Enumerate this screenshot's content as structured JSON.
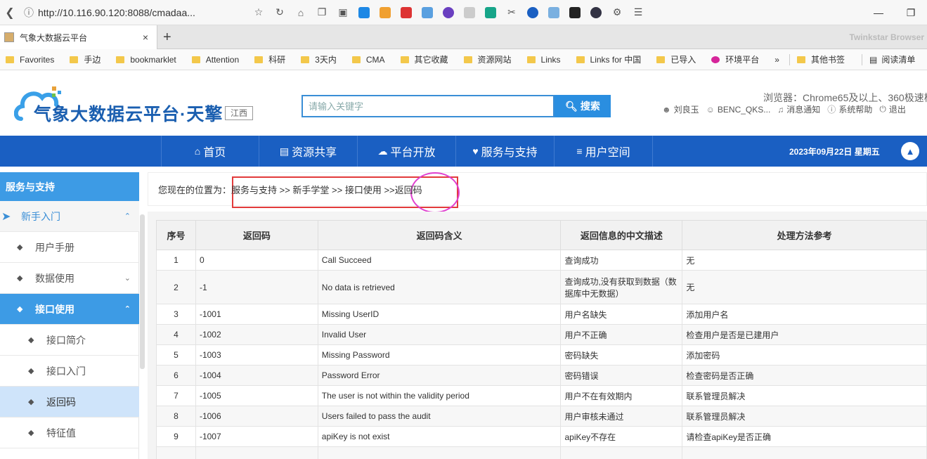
{
  "browser": {
    "url": "http://10.116.90.120:8088/cmadaa...",
    "tab_title": "气象大数据云平台",
    "brand": "Twinkstar Browser",
    "new_tab": "+",
    "close": "×"
  },
  "bookmarks": [
    "Favorites",
    "手边",
    "bookmarklet",
    "Attention",
    "科研",
    "3天内",
    "CMA",
    "其它收藏",
    "资源网站",
    "Links",
    "Links for 中国",
    "已导入",
    "环境平台",
    "»",
    "其他书签",
    "阅读清单"
  ],
  "site": {
    "logo_text": "气象大数据云平台·天擎",
    "region": "江西",
    "search_placeholder": "请输入关键字",
    "search_button": "搜索",
    "browser_note": "浏览器：Chrome65及以上、360极速模",
    "user_name": "刘良玉",
    "account": "BENC_QKS...",
    "notify": "消息通知",
    "help": "系统帮助",
    "logout": "退出"
  },
  "nav": {
    "items": [
      "首页",
      "资源共享",
      "平台开放",
      "服务与支持",
      "用户空间"
    ],
    "date": "2023年09月22日 星期五"
  },
  "sidebar": {
    "title": "服务与支持",
    "items": [
      {
        "label": "新手入门"
      },
      {
        "label": "用户手册"
      },
      {
        "label": "数据使用"
      },
      {
        "label": "接口使用"
      },
      {
        "label": "接口简介"
      },
      {
        "label": "接口入门"
      },
      {
        "label": "返回码"
      },
      {
        "label": "特征值"
      }
    ]
  },
  "breadcrumb": {
    "prefix": "您现在的位置为：",
    "path": "服务与支持 >> 新手学堂 >> 接口使用 >> ",
    "current": "返回码"
  },
  "table": {
    "headers": [
      "序号",
      "返回码",
      "返回码含义",
      "返回信息的中文描述",
      "处理方法参考"
    ],
    "rows": [
      [
        "1",
        "0",
        "Call Succeed",
        "查询成功",
        "无"
      ],
      [
        "2",
        "-1",
        "No data is retrieved",
        "查询成功,没有获取到数据（数据库中无数据）",
        "无"
      ],
      [
        "3",
        "-1001",
        "Missing UserID",
        "用户名缺失",
        "添加用户名"
      ],
      [
        "4",
        "-1002",
        "Invalid User",
        "用户不正确",
        "检查用户是否是已建用户"
      ],
      [
        "5",
        "-1003",
        "Missing Password",
        "密码缺失",
        "添加密码"
      ],
      [
        "6",
        "-1004",
        "Password Error",
        "密码错误",
        "检查密码是否正确"
      ],
      [
        "7",
        "-1005",
        "The user is not within the validity period",
        "用户不在有效期内",
        "联系管理员解决"
      ],
      [
        "8",
        "-1006",
        "Users failed to pass the audit",
        "用户审核未通过",
        "联系管理员解决"
      ],
      [
        "9",
        "-1007",
        "apiKey is not exist",
        "apiKey不存在",
        "请检查apiKey是否正确"
      ],
      [
        "",
        "",
        "",
        "",
        ""
      ]
    ]
  },
  "colors": {
    "nav_blue": "#1a5fc2",
    "sidebar_blue": "#3d9be5",
    "highlight_red": "#e23b3b",
    "highlight_magenta": "#e040d0"
  }
}
